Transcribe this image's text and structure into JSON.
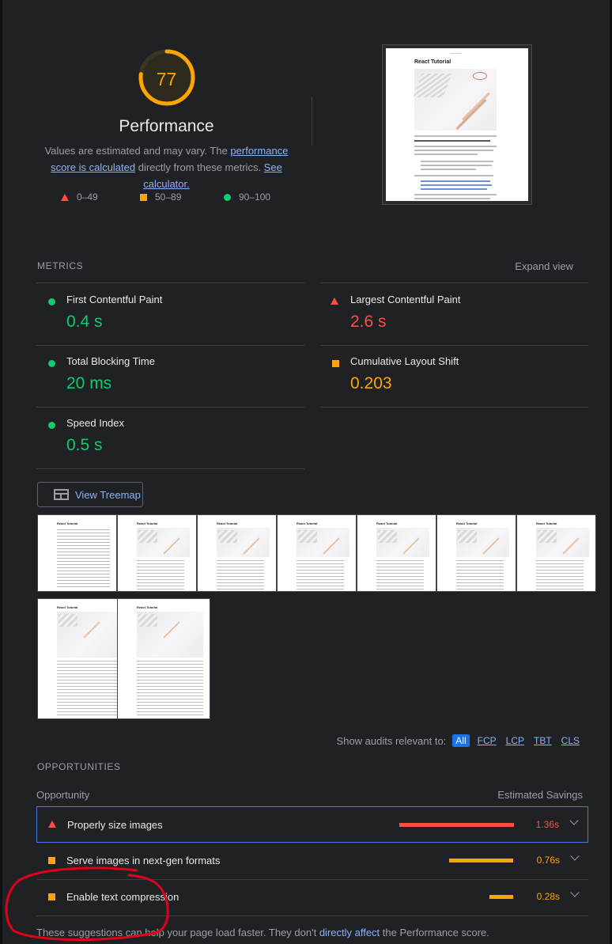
{
  "score": {
    "value": 77,
    "fraction": 0.77,
    "color": "#ffa400"
  },
  "gauge": {
    "title": "Performance",
    "desc_prefix": "Values are estimated and may vary. The ",
    "score_link": "performance score is calculated",
    "desc_mid": " directly from these metrics. ",
    "calc_link": "See calculator."
  },
  "legend": [
    {
      "icon": "triangle-icon",
      "label": "0–49",
      "color": "#ff4e42"
    },
    {
      "icon": "square-icon",
      "label": "50–89",
      "color": "#ffa400"
    },
    {
      "icon": "circle-icon",
      "label": "90–100",
      "color": "#0cce6b"
    }
  ],
  "final_screenshot": {
    "title": "React Tutorial"
  },
  "metrics_section": {
    "label": "METRICS",
    "expand_label": "Expand view",
    "items": [
      {
        "name": "First Contentful Paint",
        "value": "0.4 s",
        "status": "pass"
      },
      {
        "name": "Largest Contentful Paint",
        "value": "2.6 s",
        "status": "fail"
      },
      {
        "name": "Total Blocking Time",
        "value": "20 ms",
        "status": "pass"
      },
      {
        "name": "Cumulative Layout Shift",
        "value": "0.203",
        "status": "average"
      },
      {
        "name": "Speed Index",
        "value": "0.5 s",
        "status": "pass"
      }
    ]
  },
  "treemap": {
    "label": "View Treemap"
  },
  "filmstrip": {
    "frame_title": "React Tutorial",
    "count": 9
  },
  "filter": {
    "label": "Show audits relevant to:",
    "options": [
      "All",
      "FCP",
      "LCP",
      "TBT",
      "CLS"
    ],
    "active": "All"
  },
  "opportunities": {
    "label": "OPPORTUNITIES",
    "col_left": "Opportunity",
    "col_right": "Estimated Savings",
    "items": [
      {
        "title": "Properly size images",
        "saving": "1.36s",
        "saving_value": 1.36,
        "status": "fail"
      },
      {
        "title": "Serve images in next-gen formats",
        "saving": "0.76s",
        "saving_value": 0.76,
        "status": "average"
      },
      {
        "title": "Enable text compression",
        "saving": "0.28s",
        "saving_value": 0.28,
        "status": "average"
      }
    ]
  },
  "footer": {
    "prefix": "These suggestions can help your page load faster. They don't ",
    "link": "directly affect",
    "suffix": " the Performance score."
  },
  "colors": {
    "pass": "#0cce6b",
    "average": "#ffa400",
    "fail": "#ff4e42",
    "annotation": "#e0001a"
  }
}
